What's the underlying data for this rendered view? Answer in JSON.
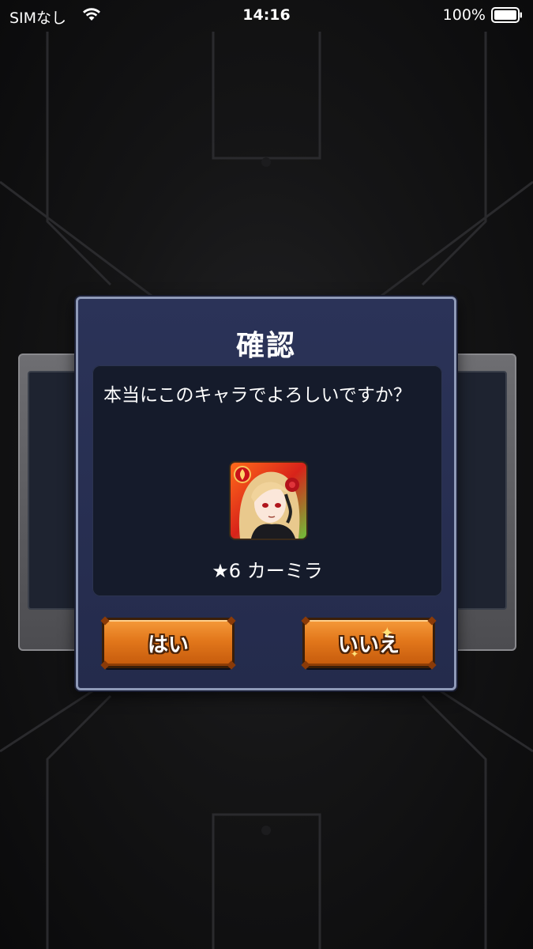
{
  "status_bar": {
    "carrier": "SIMなし",
    "time": "14:16",
    "battery": "100%"
  },
  "dialog": {
    "title": "確認",
    "message": "本当にこのキャラでよろしいですか？",
    "character": {
      "rarity_name": "★6 カーミラ",
      "element": "fire"
    },
    "buttons": {
      "yes_label": "はい",
      "no_label": "いいえ"
    }
  },
  "colors": {
    "dialog_bg": "#2b3358",
    "button_orange": "#e2771b"
  }
}
